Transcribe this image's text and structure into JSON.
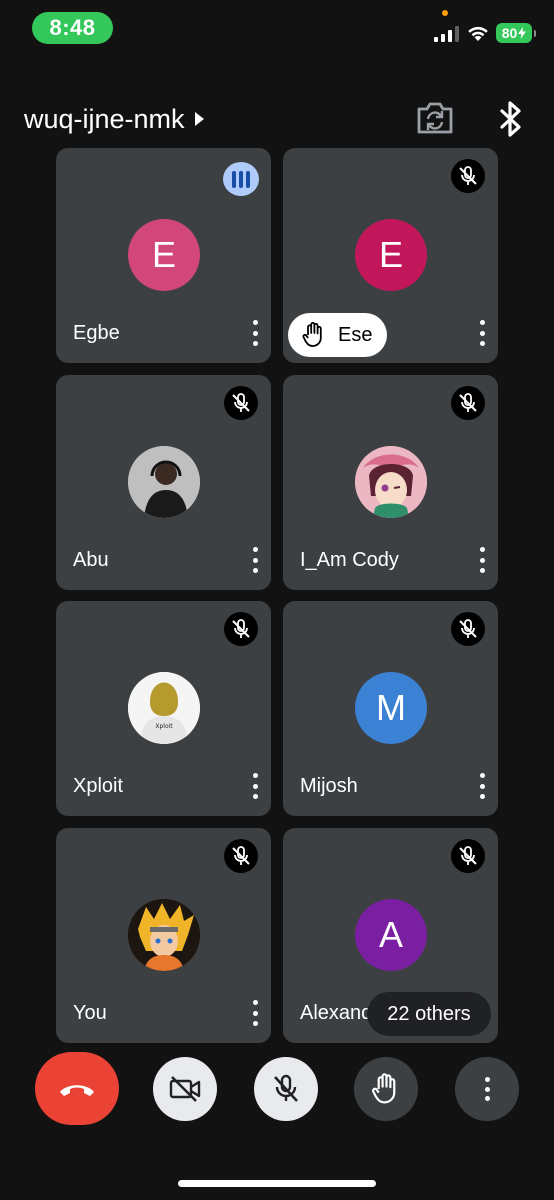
{
  "status_bar": {
    "time": "8:48",
    "battery": "80",
    "icons": [
      "cellular-signal-icon",
      "wifi-icon",
      "battery-charging-icon"
    ]
  },
  "header": {
    "meeting_code": "wuq-ijne-nmk",
    "icons": [
      "chevron-right-icon",
      "switch-camera-icon",
      "bluetooth-icon"
    ]
  },
  "participants": [
    {
      "name": "Egbe",
      "avatar_letter": "E",
      "avatar_color": "#d1477a",
      "status": "speaking"
    },
    {
      "name": "Ese",
      "avatar_letter": "E",
      "avatar_color": "#c2185b",
      "status": "muted",
      "hand_raised": true
    },
    {
      "name": "Abu",
      "avatar": "photo",
      "status": "muted"
    },
    {
      "name": "I_Am Cody",
      "avatar": "photo",
      "status": "muted"
    },
    {
      "name": "Xploit",
      "avatar": "photo",
      "avatar_text": "Xploit",
      "status": "muted"
    },
    {
      "name": "Mijosh",
      "avatar_letter": "M",
      "avatar_color": "#3b82d4",
      "status": "muted"
    },
    {
      "name": "You",
      "avatar": "photo",
      "status": "muted"
    },
    {
      "name": "Alexand",
      "avatar_letter": "A",
      "avatar_color": "#7b1fa2",
      "status": "muted",
      "overlay": "22 others"
    }
  ],
  "controls": [
    {
      "name": "end-call",
      "icon": "phone-hangup-icon",
      "color": "#ea4335"
    },
    {
      "name": "camera-toggle",
      "icon": "camera-off-icon"
    },
    {
      "name": "mic-toggle",
      "icon": "mic-off-icon"
    },
    {
      "name": "raise-hand",
      "icon": "hand-icon"
    },
    {
      "name": "more-options",
      "icon": "more-vert-icon"
    }
  ]
}
